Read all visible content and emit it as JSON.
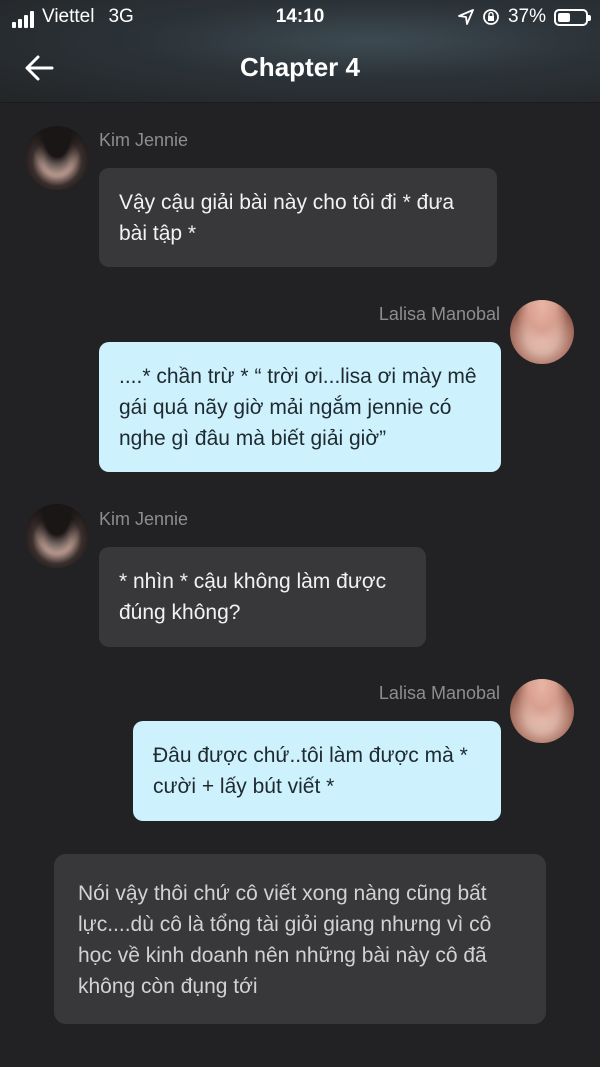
{
  "status_bar": {
    "carrier": "Viettel",
    "network": "3G",
    "time": "14:10",
    "battery": "37%"
  },
  "nav": {
    "title": "Chapter 4"
  },
  "messages": [
    {
      "sender": "Kim Jennie",
      "text": "Vậy cậu giải bài này cho tôi đi * đưa bài tập *"
    },
    {
      "sender": "Lalisa Manobal",
      "text": "....* chần trừ * “ trời ơi...lisa ơi mày mê gái quá nãy giờ mải ngắm jennie có nghe gì đâu mà biết giải giờ”"
    },
    {
      "sender": "Kim Jennie",
      "text": "* nhìn * cậu không làm được đúng không?"
    },
    {
      "sender": "Lalisa Manobal",
      "text": "Đâu được chứ..tôi làm được mà * cười + lấy bút viết *"
    }
  ],
  "narration": "Nói vậy thôi chứ cô viết xong nàng cũng bất lực....dù cô là tổng tài giỏi giang nhưng vì cô học về kinh doanh nên những bài này cô đã không còn đụng tới",
  "colors": {
    "background": "#222224",
    "left_bubble": "#38383b",
    "right_bubble": "#cdf1fd"
  }
}
